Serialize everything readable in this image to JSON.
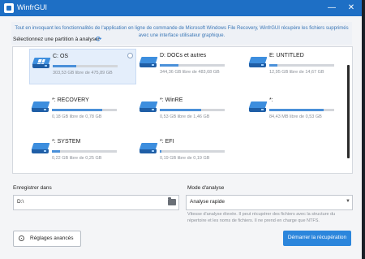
{
  "window": {
    "title": "WinfrGUI",
    "minimize_glyph": "—",
    "close_glyph": "✕"
  },
  "intro": {
    "line1": "Tout en invoquant les fonctionnalités de l'application en ligne de commande de Microsoft Windows File Recovery, WinfrGUI récupère les fichiers supprimés",
    "line2": "avec une interface utilisateur graphique."
  },
  "partition_section": {
    "label": "Sélectionnez une partition à analyser",
    "refresh_icon": "refresh-icon"
  },
  "partitions": [
    {
      "name": "C: OS",
      "size_text": "303,53 GB libre de 475,89 GB",
      "used_fraction": 0.36,
      "selected": true
    },
    {
      "name": "D: DOCs et autres",
      "size_text": "344,36 GB libre de 483,68 GB",
      "used_fraction": 0.29,
      "selected": false
    },
    {
      "name": "E: UNTITLED",
      "size_text": "12,95 GB libre de 14,67 GB",
      "used_fraction": 0.12,
      "selected": false
    },
    {
      "name": "*: RECOVERY",
      "size_text": "0,18 GB libre de 0,78 GB",
      "used_fraction": 0.77,
      "selected": false
    },
    {
      "name": "*: WinRE",
      "size_text": "0,53 GB libre de 1,46 GB",
      "used_fraction": 0.64,
      "selected": false
    },
    {
      "name": "*:",
      "size_text": "84,43 MB libre de 0,53 GB",
      "used_fraction": 0.84,
      "selected": false
    },
    {
      "name": "*: SYSTEM",
      "size_text": "0,22 GB libre de 0,25 GB",
      "used_fraction": 0.12,
      "selected": false
    },
    {
      "name": "*: EFI",
      "size_text": "0,19 GB libre de 0,19 GB",
      "used_fraction": 0.02,
      "selected": false
    }
  ],
  "save": {
    "label": "Enregistrer dans",
    "value": "D:\\",
    "icon": "folder-icon"
  },
  "mode": {
    "label": "Mode d'analyse",
    "selected": "Analyse rapide",
    "description": "Vitesse d'analyse élevée. Il peut récupérer des fichiers avec la structure du répertoire et les noms de fichiers. Il ne prend en charge que NTFS."
  },
  "buttons": {
    "advanced": "Réglages avancés",
    "start": "Démarrer la récupération"
  },
  "colors": {
    "accent": "#2c86dc",
    "titlebar": "#1e6fc5",
    "bar_fill": "#4a90d9"
  }
}
